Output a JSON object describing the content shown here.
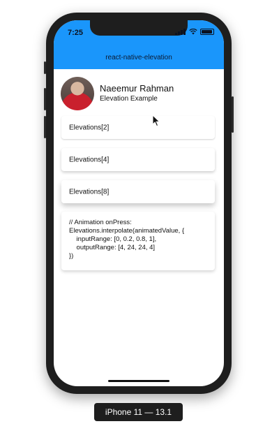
{
  "status_bar": {
    "time": "7:25"
  },
  "header": {
    "title": "react-native-elevation"
  },
  "profile": {
    "name": "Naeemur Rahman",
    "subtitle": "Elevation Example"
  },
  "cards": [
    {
      "label": "Elevations[2]"
    },
    {
      "label": "Elevations[4]"
    },
    {
      "label": "Elevations[8]"
    }
  ],
  "code": {
    "lines": [
      "// Animation onPress:",
      "Elevations.interpolate(animatedValue, {",
      "    inputRange: [0, 0.2, 0.8, 1],",
      "    outputRange: [4, 24, 24, 4]",
      "})"
    ]
  },
  "device_label": "iPhone 11 — 13.1",
  "colors": {
    "header_bg": "#1a96fb",
    "device_frame": "#1e1e1e"
  },
  "icons": [
    "signal-icon",
    "wifi-icon",
    "battery-icon",
    "cursor-icon"
  ]
}
